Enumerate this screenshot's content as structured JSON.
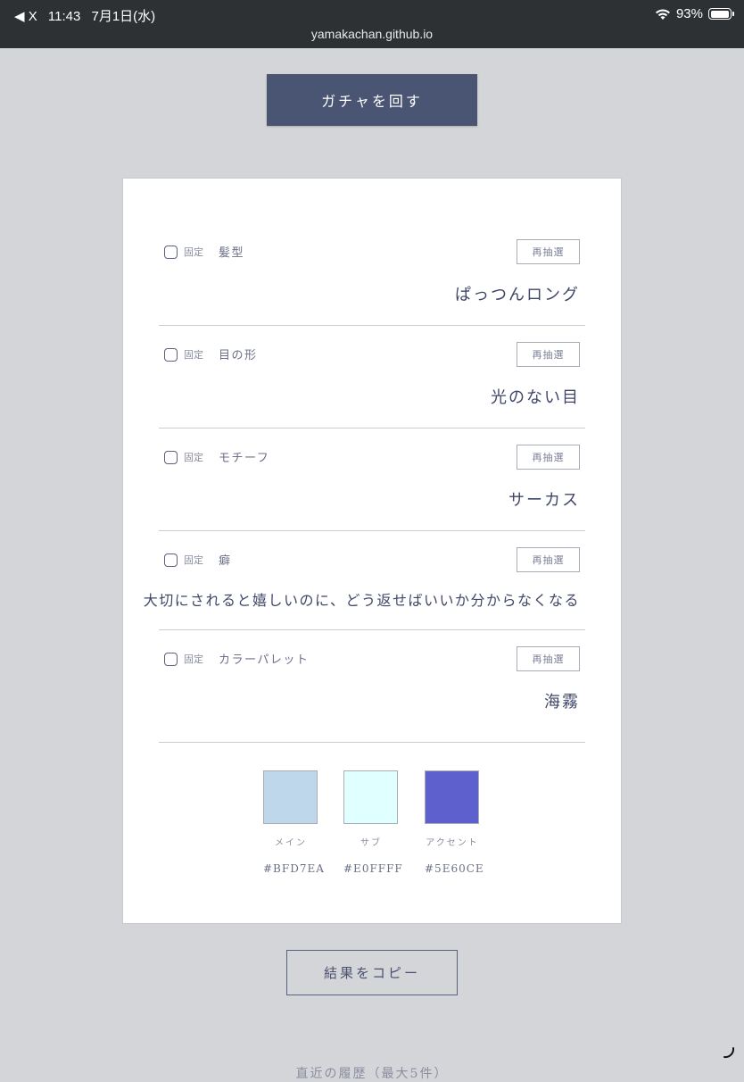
{
  "status_bar": {
    "back_label": "◀ X",
    "time": "11:43",
    "date": "7月1日(水)",
    "battery": "93%",
    "url": "yamakachan.github.io"
  },
  "gacha_button": "ガチャを回す",
  "fix_label": "固定",
  "reroll_label": "再抽選",
  "rows": [
    {
      "category": "髪型",
      "value": "ぱっつんロング"
    },
    {
      "category": "目の形",
      "value": "光のない目"
    },
    {
      "category": "モチーフ",
      "value": "サーカス"
    },
    {
      "category": "癖",
      "value": "大切にされると嬉しいのに、どう返せばいいか分からなくなる"
    },
    {
      "category": "カラーパレット",
      "value": "海霧"
    }
  ],
  "palette": [
    {
      "name": "メイン",
      "hex": "#BFD7EA",
      "color": "#BFD7EA"
    },
    {
      "name": "サブ",
      "hex": "#E0FFFF",
      "color": "#E0FFFF"
    },
    {
      "name": "アクセント",
      "hex": "#5E60CE",
      "color": "#5E60CE"
    }
  ],
  "copy_button": "結果をコピー",
  "history_label": "直近の履歴（最大5件）"
}
